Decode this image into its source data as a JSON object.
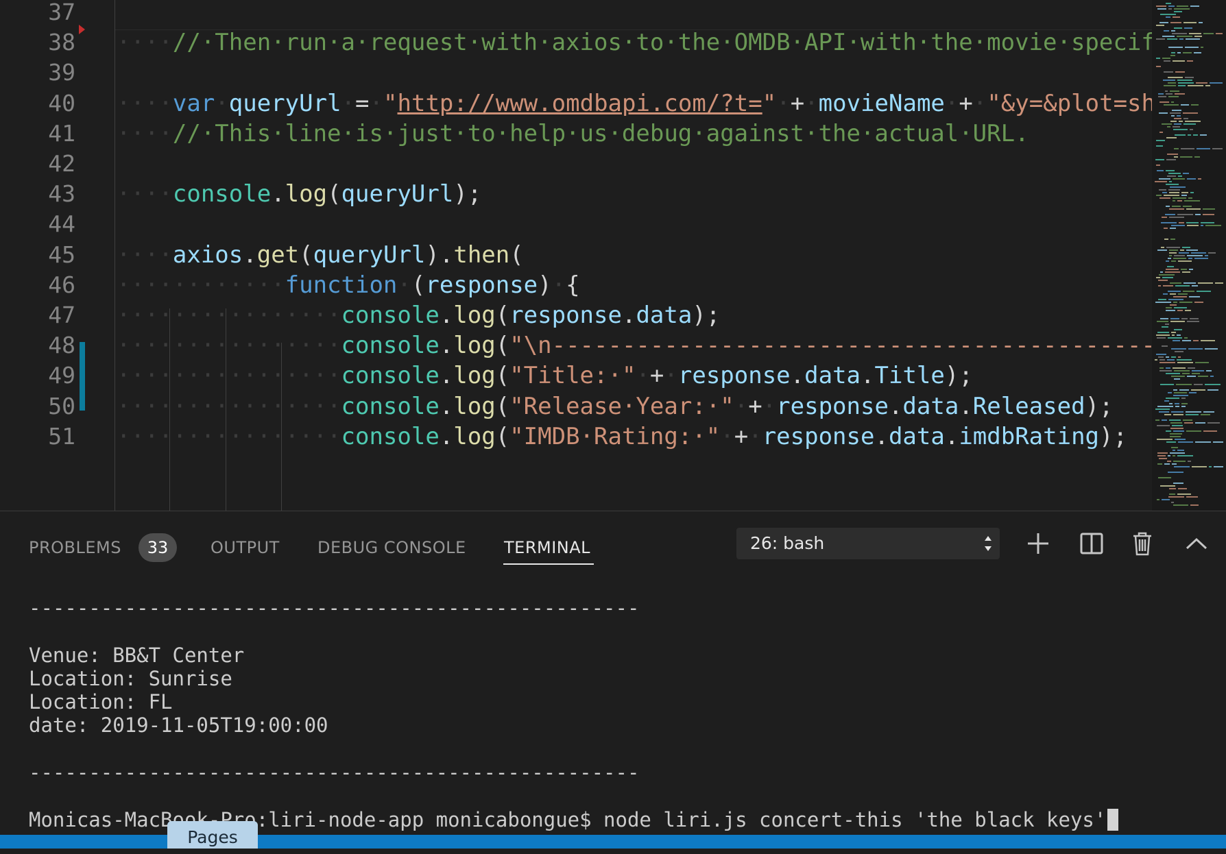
{
  "editor": {
    "lines": [
      {
        "num": "37",
        "parts": []
      },
      {
        "num": "38",
        "parts": [
          [
            "ws",
            "····"
          ],
          [
            "cm",
            "//·Then·run·a·request·with·axios·to·the·OMDB·API·with·the·movie·specifi"
          ]
        ]
      },
      {
        "num": "39",
        "parts": []
      },
      {
        "num": "40",
        "parts": [
          [
            "ws",
            "····"
          ],
          [
            "kw",
            "var"
          ],
          [
            "ws",
            "·"
          ],
          [
            "vr",
            "queryUrl"
          ],
          [
            "ws",
            "·"
          ],
          [
            "pu",
            "="
          ],
          [
            "ws",
            "·"
          ],
          [
            "st",
            "\""
          ],
          [
            "st ul",
            "http://www.omdbapi.com/?t="
          ],
          [
            "st",
            "\""
          ],
          [
            "ws",
            "·"
          ],
          [
            "pu",
            "+"
          ],
          [
            "ws",
            "·"
          ],
          [
            "vr",
            "movieName"
          ],
          [
            "ws",
            "·"
          ],
          [
            "pu",
            "+"
          ],
          [
            "ws",
            "·"
          ],
          [
            "st",
            "\"&y=&plot=sho"
          ]
        ]
      },
      {
        "num": "41",
        "parts": [
          [
            "ws",
            "····"
          ],
          [
            "cm",
            "//·This·line·is·just·to·help·us·debug·against·the·actual·URL."
          ]
        ]
      },
      {
        "num": "42",
        "parts": []
      },
      {
        "num": "43",
        "parts": [
          [
            "ws",
            "····"
          ],
          [
            "ty",
            "console"
          ],
          [
            "pu",
            "."
          ],
          [
            "fn",
            "log"
          ],
          [
            "pu",
            "("
          ],
          [
            "vr",
            "queryUrl"
          ],
          [
            "pu",
            ");"
          ]
        ]
      },
      {
        "num": "44",
        "parts": []
      },
      {
        "num": "45",
        "parts": [
          [
            "ws",
            "····"
          ],
          [
            "vr",
            "axios"
          ],
          [
            "pu",
            "."
          ],
          [
            "fn",
            "get"
          ],
          [
            "pu",
            "("
          ],
          [
            "vr",
            "queryUrl"
          ],
          [
            "pu",
            ")."
          ],
          [
            "fn",
            "then"
          ],
          [
            "pu",
            "("
          ]
        ]
      },
      {
        "num": "46",
        "parts": [
          [
            "ws",
            "············"
          ],
          [
            "kw",
            "function"
          ],
          [
            "ws",
            "·"
          ],
          [
            "pu",
            "("
          ],
          [
            "vr",
            "response"
          ],
          [
            "pu",
            ")"
          ],
          [
            "ws",
            "·"
          ],
          [
            "pu",
            "{"
          ]
        ]
      },
      {
        "num": "47",
        "parts": [
          [
            "ws",
            "················"
          ],
          [
            "ty",
            "console"
          ],
          [
            "pu",
            "."
          ],
          [
            "fn",
            "log"
          ],
          [
            "pu",
            "("
          ],
          [
            "vr",
            "response"
          ],
          [
            "pu",
            "."
          ],
          [
            "vr",
            "data"
          ],
          [
            "pu",
            ");"
          ]
        ]
      },
      {
        "num": "48",
        "parts": [
          [
            "ws",
            "················"
          ],
          [
            "ty",
            "console"
          ],
          [
            "pu",
            "."
          ],
          [
            "fn",
            "log"
          ],
          [
            "pu",
            "("
          ],
          [
            "st",
            "\"\\n------------------------------------------------"
          ]
        ]
      },
      {
        "num": "49",
        "parts": [
          [
            "ws",
            "················"
          ],
          [
            "ty",
            "console"
          ],
          [
            "pu",
            "."
          ],
          [
            "fn",
            "log"
          ],
          [
            "pu",
            "("
          ],
          [
            "st",
            "\"Title:·\""
          ],
          [
            "ws",
            "·"
          ],
          [
            "pu",
            "+"
          ],
          [
            "ws",
            "·"
          ],
          [
            "vr",
            "response"
          ],
          [
            "pu",
            "."
          ],
          [
            "vr",
            "data"
          ],
          [
            "pu",
            "."
          ],
          [
            "vr",
            "Title"
          ],
          [
            "pu",
            ");"
          ]
        ]
      },
      {
        "num": "50",
        "parts": [
          [
            "ws",
            "················"
          ],
          [
            "ty",
            "console"
          ],
          [
            "pu",
            "."
          ],
          [
            "fn",
            "log"
          ],
          [
            "pu",
            "("
          ],
          [
            "st",
            "\"Release·Year:·\""
          ],
          [
            "ws",
            "·"
          ],
          [
            "pu",
            "+"
          ],
          [
            "ws",
            "·"
          ],
          [
            "vr",
            "response"
          ],
          [
            "pu",
            "."
          ],
          [
            "vr",
            "data"
          ],
          [
            "pu",
            "."
          ],
          [
            "vr",
            "Released"
          ],
          [
            "pu",
            ");"
          ]
        ]
      },
      {
        "num": "51",
        "parts": [
          [
            "ws",
            "················"
          ],
          [
            "ty",
            "console"
          ],
          [
            "pu",
            "."
          ],
          [
            "fn",
            "log"
          ],
          [
            "pu",
            "("
          ],
          [
            "st",
            "\"IMDB·Rating:·\""
          ],
          [
            "ws",
            "·"
          ],
          [
            "pu",
            "+"
          ],
          [
            "ws",
            "·"
          ],
          [
            "vr",
            "response"
          ],
          [
            "pu",
            "."
          ],
          [
            "vr",
            "data"
          ],
          [
            "pu",
            "."
          ],
          [
            "vr",
            "imdbRating"
          ],
          [
            "pu",
            ");"
          ]
        ]
      }
    ]
  },
  "panel": {
    "tabs": {
      "problems": "PROBLEMS",
      "problems_count": "33",
      "output": "OUTPUT",
      "debug_console": "DEBUG CONSOLE",
      "terminal": "TERMINAL"
    },
    "terminal_select": "26: bash",
    "icons": {
      "new_terminal": "plus-icon",
      "split": "split-icon",
      "kill": "trash-icon",
      "maximize": "chevron-up-icon"
    }
  },
  "terminal": {
    "separator1": "---------------------------------------------------",
    "venue": "Venue: BB&T Center",
    "location_city": "Location: Sunrise",
    "location_state": "Location: FL",
    "date": "date: 2019-11-05T19:00:00",
    "separator2": "---------------------------------------------------",
    "prompt": "Monicas-MacBook-Pro:liri-node-app monicabongue$ node liri.js concert-this 'the black keys'"
  },
  "tooltip": {
    "label": "Pages"
  },
  "colors": {
    "statusbar": "#0e7ac4",
    "background": "#1e1e1e"
  }
}
